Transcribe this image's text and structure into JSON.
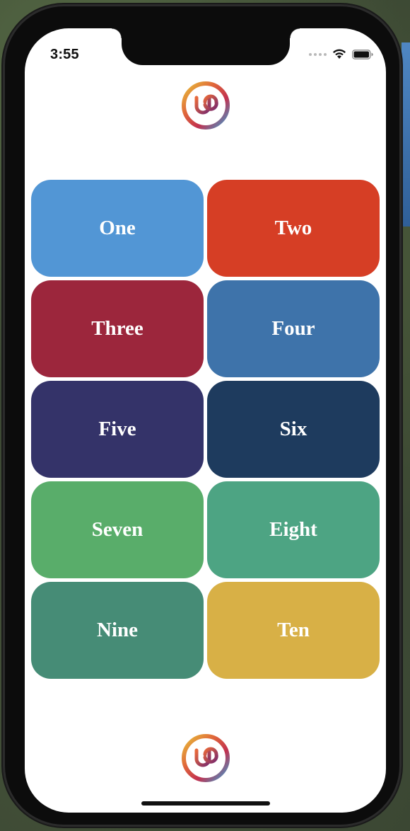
{
  "status_bar": {
    "time": "3:55"
  },
  "tiles": [
    {
      "label": "One",
      "color": "#5296d5"
    },
    {
      "label": "Two",
      "color": "#d63e25"
    },
    {
      "label": "Three",
      "color": "#9c263c"
    },
    {
      "label": "Four",
      "color": "#3e73aa"
    },
    {
      "label": "Five",
      "color": "#343369"
    },
    {
      "label": "Six",
      "color": "#1e3b5e"
    },
    {
      "label": "Seven",
      "color": "#59ad6a"
    },
    {
      "label": "Eight",
      "color": "#4da483"
    },
    {
      "label": "Nine",
      "color": "#468c76"
    },
    {
      "label": "Ten",
      "color": "#d8b046"
    }
  ],
  "icons": {
    "logo": "app-logo-icon",
    "wifi": "wifi-icon",
    "battery": "battery-icon",
    "signal": "cellular-signal-icon"
  }
}
